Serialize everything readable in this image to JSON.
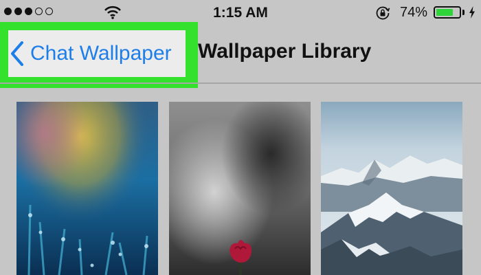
{
  "status_bar": {
    "signal_dots_filled": 3,
    "signal_dots_total": 5,
    "time": "1:15 AM",
    "battery_percent": "74%",
    "battery_level": 0.74,
    "icons": [
      "wifi-icon",
      "orientation-lock-icon",
      "battery-icon",
      "charging-icon"
    ]
  },
  "nav": {
    "back_label": "Chat Wallpaper",
    "title": "Wallpaper Library",
    "back_icon": "chevron-left-icon"
  },
  "wallpapers": [
    {
      "name": "dewy-grass-wallpaper"
    },
    {
      "name": "red-flower-wallpaper"
    },
    {
      "name": "snowy-mountains-wallpaper"
    }
  ],
  "colors": {
    "highlight": "#34e22d",
    "link": "#1e7ee8",
    "battery": "#2fd33a",
    "background": "#c6c6c6"
  }
}
